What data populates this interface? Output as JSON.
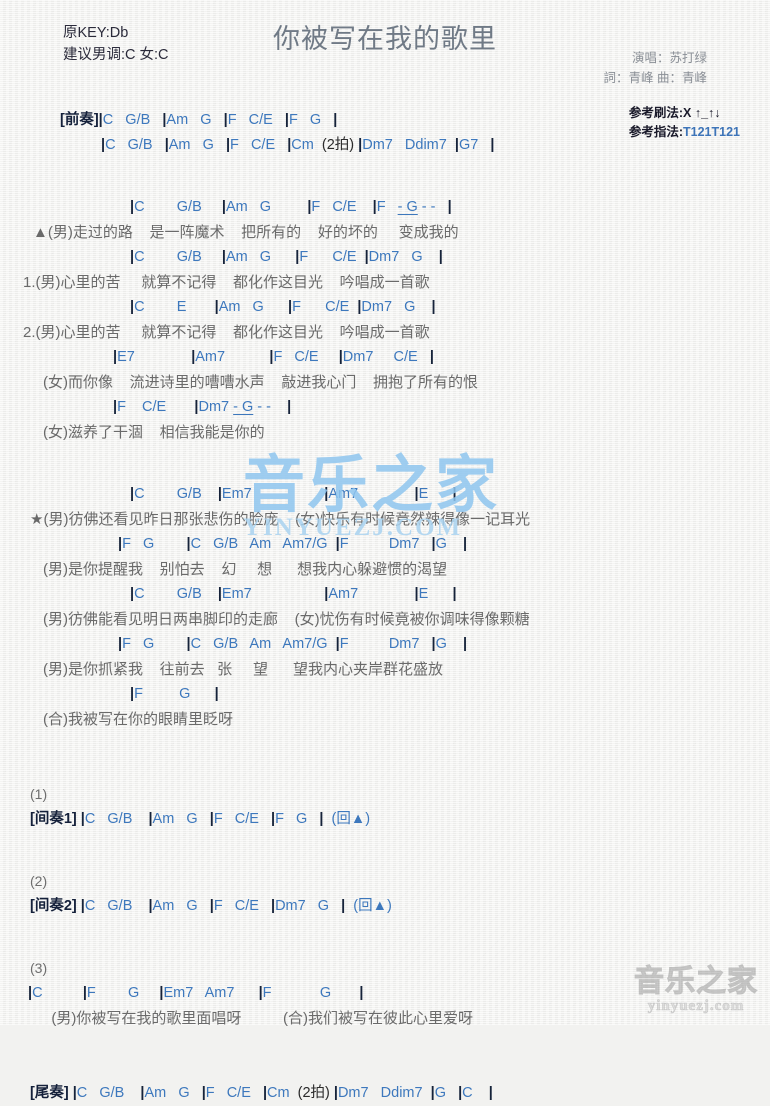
{
  "header": {
    "key_original": "原KEY:Db",
    "key_suggested": "建议男调:C 女:C",
    "title": "你被写在我的歌里",
    "singer": "演唱：苏打绿",
    "writers": "詞：青峰  曲：青峰",
    "strum_label": "参考刷法:",
    "strum_value": "X ↑_↑↓",
    "finger_label": "参考指法:",
    "finger_value": "T121T121"
  },
  "colors": {
    "chord_blue": "#3d78bd",
    "bar_dark": "#16233a",
    "lyric_gray": "#6a6a6a",
    "title_gray": "#707a86",
    "watermark_blue": "#8fc6ef",
    "page_bg": "#f2f2f0"
  },
  "intro": {
    "label": "[前奏]",
    "line1": "|C   G/B   |Am   G   |F   C/E   |F   G   |",
    "line2": "|C   G/B   |Am   G   |F   C/E   |Cm  (2拍) |Dm7   Ddim7  |G7   |"
  },
  "verses": [
    {
      "name": "verse-a",
      "chords": "|C        G/B     |Am   G         |F   C/E    |F   - G - -   |",
      "lyrics": "▲(男)走过的路    是一阵魔术    把所有的    好的坏的     变成我的"
    },
    {
      "name": "verse-1",
      "chords": "|C        G/B     |Am   G      |F      C/E  |Dm7   G    |",
      "lyrics": "1.(男)心里的苦     就算不记得    都化作这目光    吟唱成一首歌"
    },
    {
      "name": "verse-2",
      "chords": "|C        E       |Am   G      |F      C/E  |Dm7   G    |",
      "lyrics": "2.(男)心里的苦     就算不记得    都化作这目光    吟唱成一首歌"
    },
    {
      "name": "verse-female-1",
      "chords": "|E7              |Am7           |F   C/E     |Dm7     C/E   |",
      "lyrics": "(女)而你像    流进诗里的嘈嘈水声    敲进我心门    拥抱了所有的恨"
    },
    {
      "name": "verse-female-2",
      "chords": "|F    C/E       |Dm7 - G - -    |",
      "lyrics": "(女)滋养了干涸    相信我能是你的"
    }
  ],
  "chorus": [
    {
      "name": "chorus-line-1",
      "chords": "|C        G/B    |Em7                  |Am7              |E      |",
      "lyrics": "★(男)彷佛还看见昨日那张悲伤的脸庞    (女)快乐有时候竟然辣得像一记耳光"
    },
    {
      "name": "chorus-line-2",
      "chords": "|F   G        |C   G/B   Am   Am7/G  |F          Dm7   |G    |",
      "lyrics": "(男)是你提醒我    别怕去    幻     想      想我内心躲避惯的渴望"
    },
    {
      "name": "chorus-line-3",
      "chords": "|C        G/B    |Em7                  |Am7              |E      |",
      "lyrics": "(男)彷佛能看见明日两串脚印的走廊    (女)忧伤有时候竟被你调味得像颗糖"
    },
    {
      "name": "chorus-line-4",
      "chords": "|F   G        |C   G/B   Am   Am7/G  |F          Dm7   |G    |",
      "lyrics": "(男)是你抓紧我    往前去   张     望      望我内心夹岸群花盛放"
    },
    {
      "name": "chorus-line-5",
      "chords": "|F         G      |",
      "lyrics": "(合)我被写在你的眼睛里眨呀"
    }
  ],
  "interludes": [
    {
      "number": "(1)",
      "label": "[间奏1]",
      "chords": "|C   G/B    |Am   G   |F   C/E   |F   G   |  (回▲)"
    },
    {
      "number": "(2)",
      "label": "[间奏2]",
      "chords": "|C   G/B    |Am   G   |F   C/E   |Dm7   G   |  (回▲)"
    }
  ],
  "section3": {
    "number": "(3)",
    "chords": "|C          |F        G     |Em7   Am7      |F            G       |",
    "lyrics": "  (男)你被写在我的歌里面唱呀          (合)我们被写在彼此心里爱呀"
  },
  "outro": {
    "label": "[尾奏]",
    "chords": "|C   G/B    |Am   G   |F   C/E   |Cm  (2拍) |Dm7   Ddim7  |G   |C    |"
  },
  "watermarks": {
    "center_cn": "音乐之家",
    "center_en": "YINYUEZJ.COM",
    "corner_cn": "音乐之家",
    "corner_en": "yinyuezj.com"
  }
}
